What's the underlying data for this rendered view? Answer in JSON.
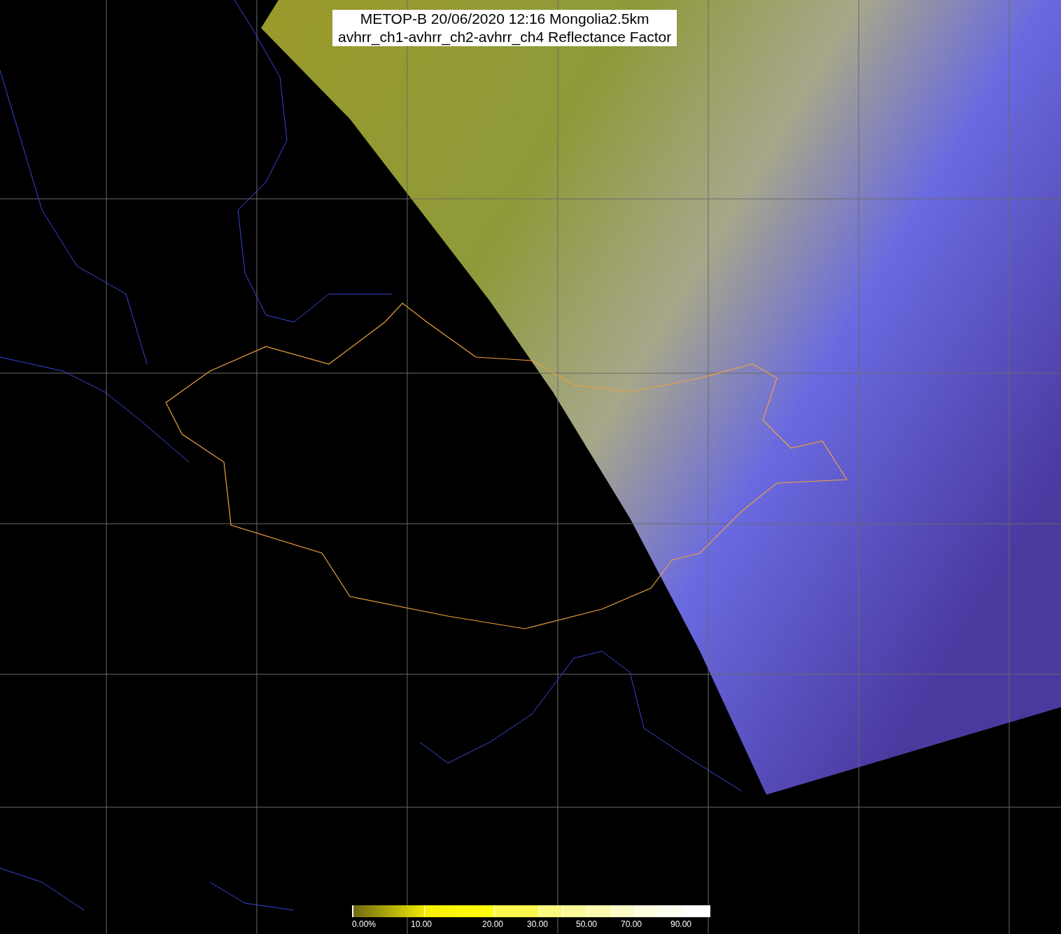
{
  "title": {
    "lines": [
      "METOP-B 20/06/2020 12:16 Mongolia2.5km",
      "avhrr_ch1-avhrr_ch2-avhrr_ch4 Reflectance Factor"
    ]
  },
  "colorbar": {
    "labels": [
      "0.00%",
      "10.00",
      "20.00",
      "30.00",
      "50.00",
      "70.00",
      "90.00"
    ]
  }
}
